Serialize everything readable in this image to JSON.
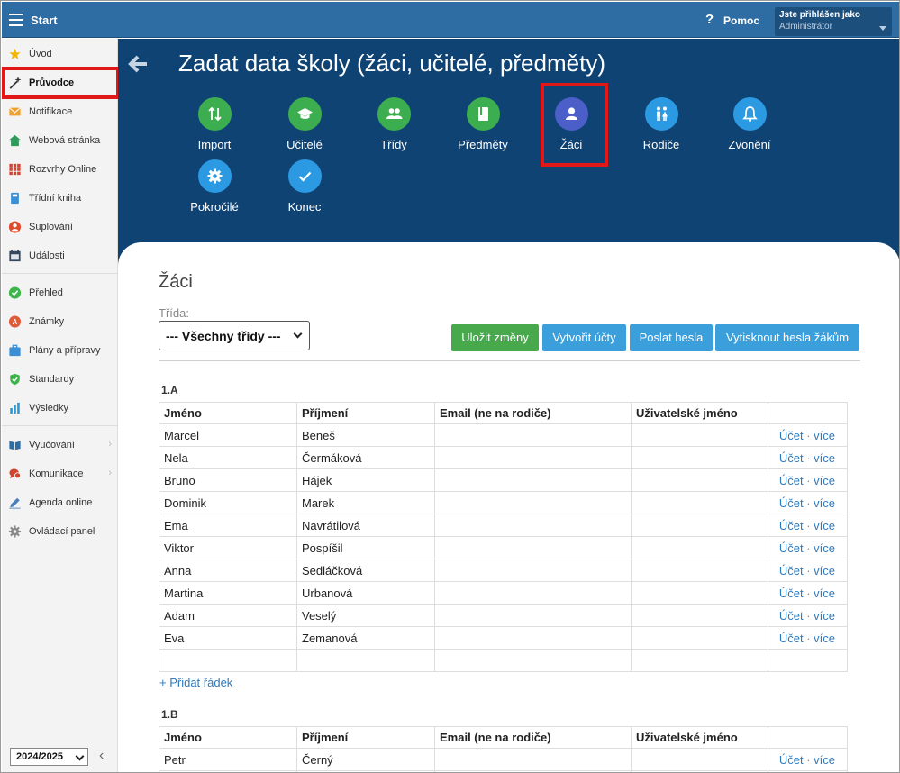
{
  "topbar": {
    "start_label": "Start",
    "help_icon": "?",
    "help_label": "Pomoc",
    "user_line1": "Jste přihlášen jako",
    "user_line2": "Administrátor"
  },
  "sidebar": {
    "items": [
      {
        "label": "Úvod",
        "icon": "star-icon",
        "color": "#f2b705"
      },
      {
        "label": "Průvodce",
        "icon": "magic-wand-icon",
        "color": "#333333"
      },
      {
        "label": "Notifikace",
        "icon": "envelope-icon",
        "color": "#f0a030"
      },
      {
        "label": "Webová stránka",
        "icon": "house-icon",
        "color": "#2e9a5c"
      },
      {
        "label": "Rozvrhy Online",
        "icon": "calendar-grid-icon",
        "color": "#d04530"
      },
      {
        "label": "Třídní kniha",
        "icon": "book-icon",
        "color": "#3b8fd4"
      },
      {
        "label": "Suplování",
        "icon": "person-icon",
        "color": "#e04a2a"
      },
      {
        "label": "Události",
        "icon": "calendar-icon",
        "color": "#34495e"
      },
      {
        "label": "Přehled",
        "icon": "check-circle-icon",
        "color": "#3cb54a"
      },
      {
        "label": "Známky",
        "icon": "grade-icon",
        "color": "#e05a3a"
      },
      {
        "label": "Plány a přípravy",
        "icon": "briefcase-icon",
        "color": "#3b8fd4"
      },
      {
        "label": "Standardy",
        "icon": "shield-icon",
        "color": "#3cb54a"
      },
      {
        "label": "Výsledky",
        "icon": "bar-chart-icon",
        "color": "#2b9bd6"
      },
      {
        "label": "Vyučování",
        "icon": "open-book-icon",
        "color": "#2e6da4"
      },
      {
        "label": "Komunikace",
        "icon": "chat-icon",
        "color": "#d04530"
      },
      {
        "label": "Agenda online",
        "icon": "pencil-icon",
        "color": "#4a7fb8"
      },
      {
        "label": "Ovládací panel",
        "icon": "gear-icon",
        "color": "#8a8a8a"
      }
    ],
    "year": "2024/2025"
  },
  "header": {
    "title": "Zadat data školy (žáci, učitelé, předměty)",
    "steps": [
      {
        "label": "Import",
        "icon": "import-icon",
        "color": "#3cae4f"
      },
      {
        "label": "Učitelé",
        "icon": "graduation-cap-icon",
        "color": "#3cae4f"
      },
      {
        "label": "Třídy",
        "icon": "group-icon",
        "color": "#3cae4f"
      },
      {
        "label": "Předměty",
        "icon": "book-icon",
        "color": "#3cae4f"
      },
      {
        "label": "Žáci",
        "icon": "person-icon",
        "color": "#4c5ec8"
      },
      {
        "label": "Rodiče",
        "icon": "family-icon",
        "color": "#2b9ae3"
      },
      {
        "label": "Zvonění",
        "icon": "bell-icon",
        "color": "#2b9ae3"
      },
      {
        "label": "Pokročilé",
        "icon": "gear-icon",
        "color": "#2b9ae3"
      },
      {
        "label": "Konec",
        "icon": "check-icon",
        "color": "#2b9ae3"
      }
    ]
  },
  "content": {
    "section_title": "Žáci",
    "class_label": "Třída:",
    "class_select": "--- Všechny třídy ---",
    "buttons": {
      "save": "Uložit změny",
      "create_accounts": "Vytvořit účty",
      "send_passwords": "Poslat hesla",
      "print_passwords": "Vytisknout hesla žákům"
    },
    "columns": [
      "Jméno",
      "Příjmení",
      "Email (ne na rodiče)",
      "Uživatelské jméno"
    ],
    "account_link": "Účet",
    "separator": "·",
    "more_link": "více",
    "add_row": "+ Přidat řádek",
    "classes": [
      {
        "name": "1.A",
        "students": [
          {
            "first": "Marcel",
            "last": "Beneš"
          },
          {
            "first": "Nela",
            "last": "Čermáková"
          },
          {
            "first": "Bruno",
            "last": "Hájek"
          },
          {
            "first": "Dominik",
            "last": "Marek"
          },
          {
            "first": "Ema",
            "last": "Navrátilová"
          },
          {
            "first": "Viktor",
            "last": "Pospíšil"
          },
          {
            "first": "Anna",
            "last": "Sedláčková"
          },
          {
            "first": "Martina",
            "last": "Urbanová"
          },
          {
            "first": "Adam",
            "last": "Veselý"
          },
          {
            "first": "Eva",
            "last": "Zemanová"
          }
        ]
      },
      {
        "name": "1.B",
        "students": [
          {
            "first": "Petr",
            "last": "Černý"
          }
        ]
      }
    ]
  }
}
